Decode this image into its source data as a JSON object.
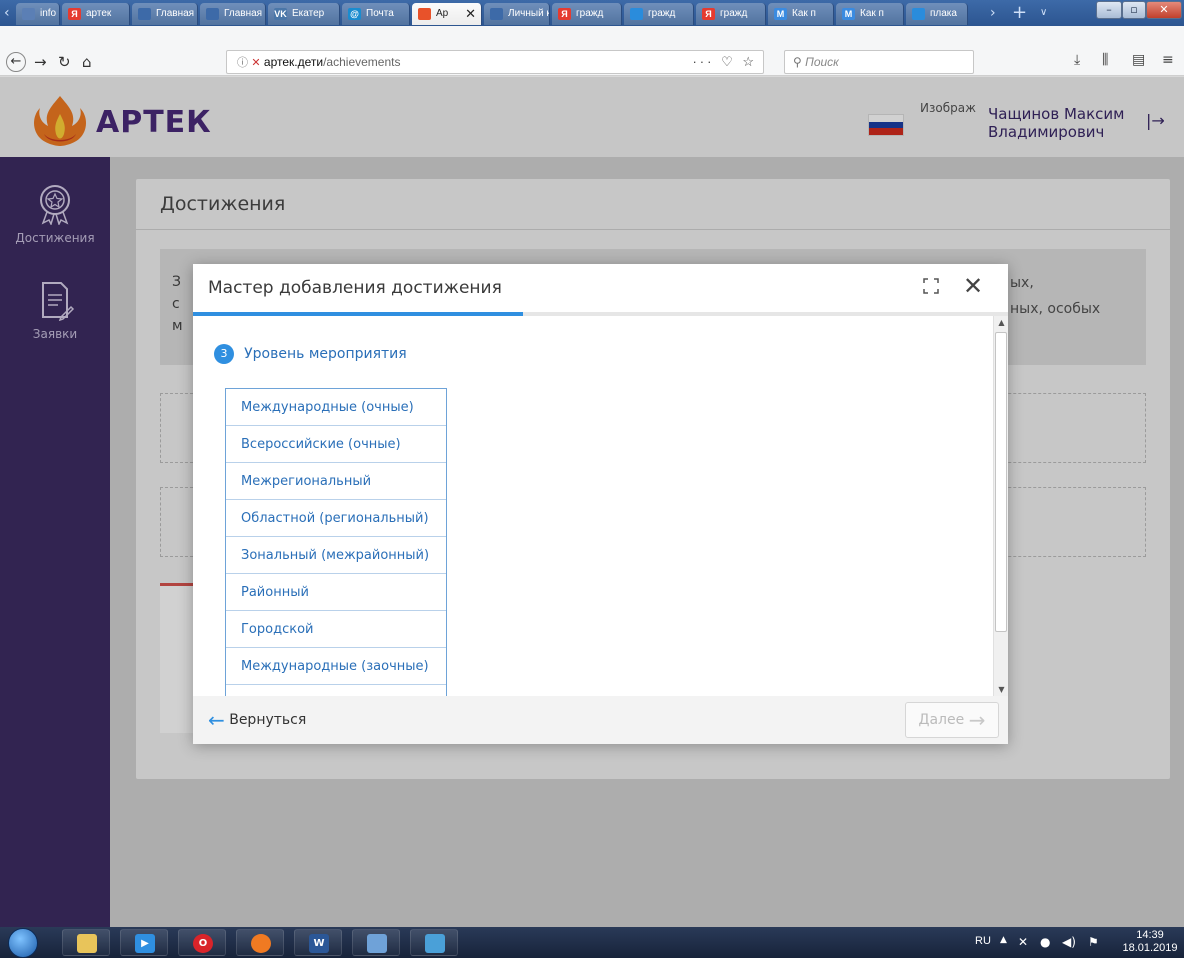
{
  "browser": {
    "tabs": [
      {
        "label": "info",
        "icon_text": "",
        "icon_color": "#5b7fb5"
      },
      {
        "label": "артек",
        "icon_text": "Я",
        "icon_color": "#e53b30"
      },
      {
        "label": "Главная",
        "icon_text": "",
        "icon_color": "#3d6aa8"
      },
      {
        "label": "Главная",
        "icon_text": "",
        "icon_color": "#3d6aa8"
      },
      {
        "label": "Екатер",
        "icon_text": "VK",
        "icon_color": "#4a76a8"
      },
      {
        "label": "Почта",
        "icon_text": "@",
        "icon_color": "#1a8ccf"
      },
      {
        "label": "Ар",
        "icon_text": "",
        "icon_color": "#e8522a"
      },
      {
        "label": "Личный к",
        "icon_text": "",
        "icon_color": "#3d6aa8"
      },
      {
        "label": "гражд",
        "icon_text": "Я",
        "icon_color": "#e53b30"
      },
      {
        "label": "гражд",
        "icon_text": "",
        "icon_color": "#2a8cdc"
      },
      {
        "label": "гражд",
        "icon_text": "Я",
        "icon_color": "#e53b30"
      },
      {
        "label": "Как п",
        "icon_text": "M",
        "icon_color": "#3b8be0"
      },
      {
        "label": "Как п",
        "icon_text": "M",
        "icon_color": "#3b8be0"
      },
      {
        "label": "плака",
        "icon_text": "",
        "icon_color": "#2a8cdc"
      }
    ],
    "url_host": "артек.дети",
    "url_path": "/achievements",
    "url_actions": "··· ♡ ☆",
    "search_placeholder": "Поиск"
  },
  "site": {
    "logo_text": "АРТЕК",
    "user_role": "Изображение пользователя",
    "user_name_line1": "Чащинов Максим",
    "user_name_line2": "Владимирович",
    "sidebar": [
      {
        "label": "Достижения"
      },
      {
        "label": "Заявки"
      }
    ],
    "page_title": "Достижения",
    "info_line1_start": "З",
    "info_line2_start": "с",
    "info_line3_start": "м",
    "info_line1_end": "ых,",
    "info_line2_end": "ных, особых"
  },
  "modal": {
    "title": "Мастер добавления достижения",
    "progress": 0.5,
    "step_number": "3",
    "step_label": "Уровень мероприятия",
    "options": [
      "Международные (очные)",
      "Всероссийские (очные)",
      "Межрегиональный",
      "Областной (региональный)",
      "Зональный (межрайонный)",
      "Районный",
      "Городской",
      "Международные (заочные)"
    ],
    "back_label": "Вернуться",
    "next_label": "Далее"
  },
  "taskbar": {
    "lang": "RU",
    "time": "14:39",
    "date": "18.01.2019"
  },
  "colors": {
    "accent": "#2f8fe0",
    "sidebar": "#3e2d63",
    "brand": "#4a2a7a"
  }
}
